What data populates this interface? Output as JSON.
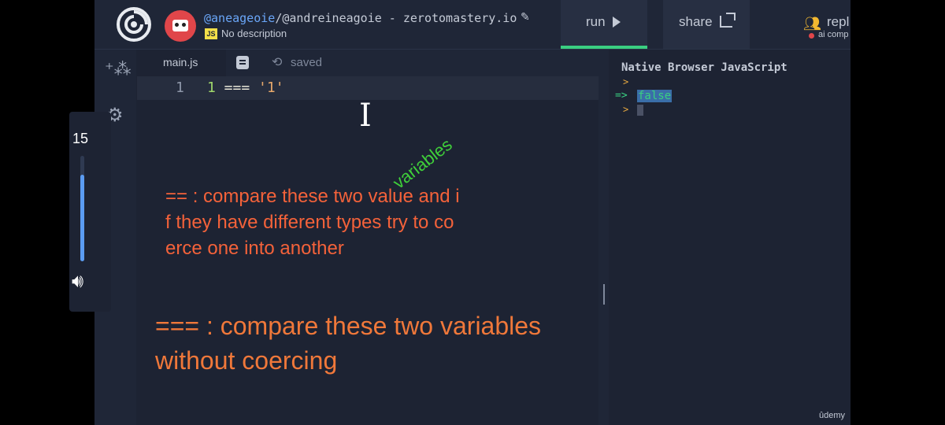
{
  "header": {
    "repl_user": "@aneageoie",
    "repl_path": "/@andreineagoie - zerotomastery.io",
    "language_badge": "JS",
    "description": "No description",
    "run_label": "run",
    "share_label": "share",
    "team_label": "repl",
    "team_sub": "ai comp"
  },
  "editor": {
    "tab_name": "main.js",
    "status": "saved",
    "line_number": "1",
    "code_num": "1",
    "code_op": " === ",
    "code_str": "'1'"
  },
  "console": {
    "title": "Native Browser JavaScript",
    "prompt": ">",
    "arrow": "=>",
    "result": "false"
  },
  "player": {
    "volume_value": "15",
    "volume_level": 0.82,
    "watermark": "ûdemy"
  },
  "annotations": {
    "note1_line1": "== : compare these two value and i",
    "note1_line2": "f they have different types try to co",
    "note1_line3": "erce one into another",
    "note1_overlay": "variables",
    "note2_line1": "=== : compare these two variables",
    "note2_line2": "without coercing"
  },
  "colors": {
    "run_accent": "#3acf81",
    "note_orange": "#f4623a",
    "overlay_green": "#3fcf3a"
  }
}
